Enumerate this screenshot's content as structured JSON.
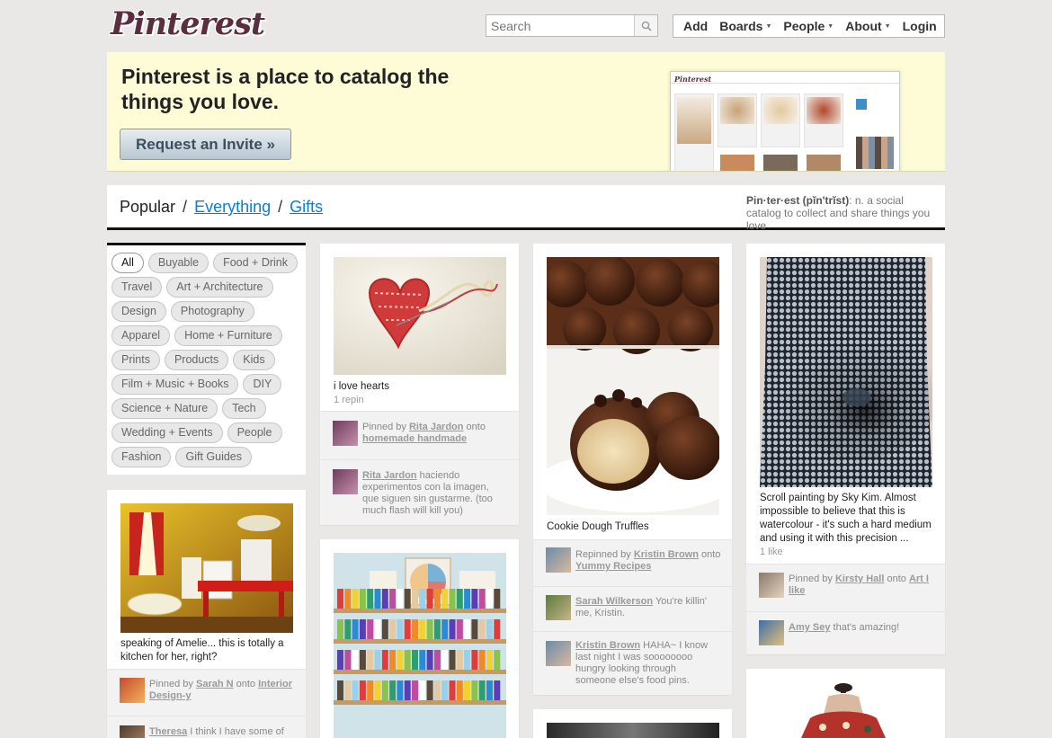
{
  "header": {
    "logo": "Pinterest",
    "search_placeholder": "Search",
    "nav": [
      {
        "label": "Add",
        "caret": false
      },
      {
        "label": "Boards",
        "caret": true
      },
      {
        "label": "People",
        "caret": true
      },
      {
        "label": "About",
        "caret": true
      },
      {
        "label": "Login",
        "caret": false
      }
    ]
  },
  "banner": {
    "headline": "Pinterest is a place to catalog the things you love.",
    "invite_button": "Request an Invite »",
    "preview_logo": "Pinterest"
  },
  "crumbs": {
    "current": "Popular",
    "sep": "/",
    "link1": "Everything",
    "link2": "Gifts",
    "def_term": "Pin·ter·est (pĭn'trĭst)",
    "def_text": ": n. a social catalog to collect and share things you love"
  },
  "categories": [
    [
      "All",
      "Buyable",
      "Food + Drink"
    ],
    [
      "Travel",
      "Art + Architecture"
    ],
    [
      "Design",
      "Photography"
    ],
    [
      "Apparel",
      "Home + Furniture"
    ],
    [
      "Prints",
      "Products",
      "Kids"
    ],
    [
      "Film + Music + Books",
      "DIY"
    ],
    [
      "Science + Nature",
      "Tech"
    ],
    [
      "Wedding + Events",
      "People"
    ],
    [
      "Fashion",
      "Gift Guides"
    ]
  ],
  "pins": {
    "hearts": {
      "desc": "i love hearts",
      "stat": "1 repin",
      "a1_pre": "Pinned by ",
      "a1_user": "Rita Jardon",
      "a1_mid": " onto ",
      "a1_board": "homemade handmade",
      "a2_user": "Rita Jardon",
      "a2_text": " haciendo experimentos con la imagen, que siguen sin gustarme. (too much flash will kill you)"
    },
    "kitchen": {
      "desc": "speaking of Amelie... this is totally a kitchen for her, right?",
      "a1_pre": "Pinned by ",
      "a1_user": "Sarah N",
      "a1_mid": " onto ",
      "a1_board": "Interior Design-y",
      "a2_user": "Theresa",
      "a2_text": " I think I have some of"
    },
    "truffles": {
      "desc": "Cookie Dough Truffles",
      "a1_pre": "Repinned by ",
      "a1_user": "Kristin Brown",
      "a1_mid": " onto ",
      "a1_board": "Yummy Recipes",
      "a2_user": "Sarah Wilkerson",
      "a2_text": " You're killin' me, Kristin.",
      "a3_user": "Kristin Brown",
      "a3_text": " HAHA~ I know last night I was soooooooo hungry looking through someone else's food pins."
    },
    "scroll": {
      "desc": "Scroll painting by Sky Kim. Almost impossible to believe that this is watercolour - it's such a hard medium and using it with this precision ...",
      "stat": "1 like",
      "a1_pre": "Pinned by ",
      "a1_user": "Kirsty Hall",
      "a1_mid": " onto ",
      "a1_board": "Art I like",
      "a2_user": "Amy Sey",
      "a2_text": " that's amazing!"
    }
  },
  "colors": {
    "background": "#e9e8e6",
    "banner": "#fdfcd7",
    "link": "#0a7ed3",
    "logo": "#5b2d3f"
  },
  "icons": {
    "search": "magnifier-icon",
    "caret": "caret-down-icon"
  }
}
